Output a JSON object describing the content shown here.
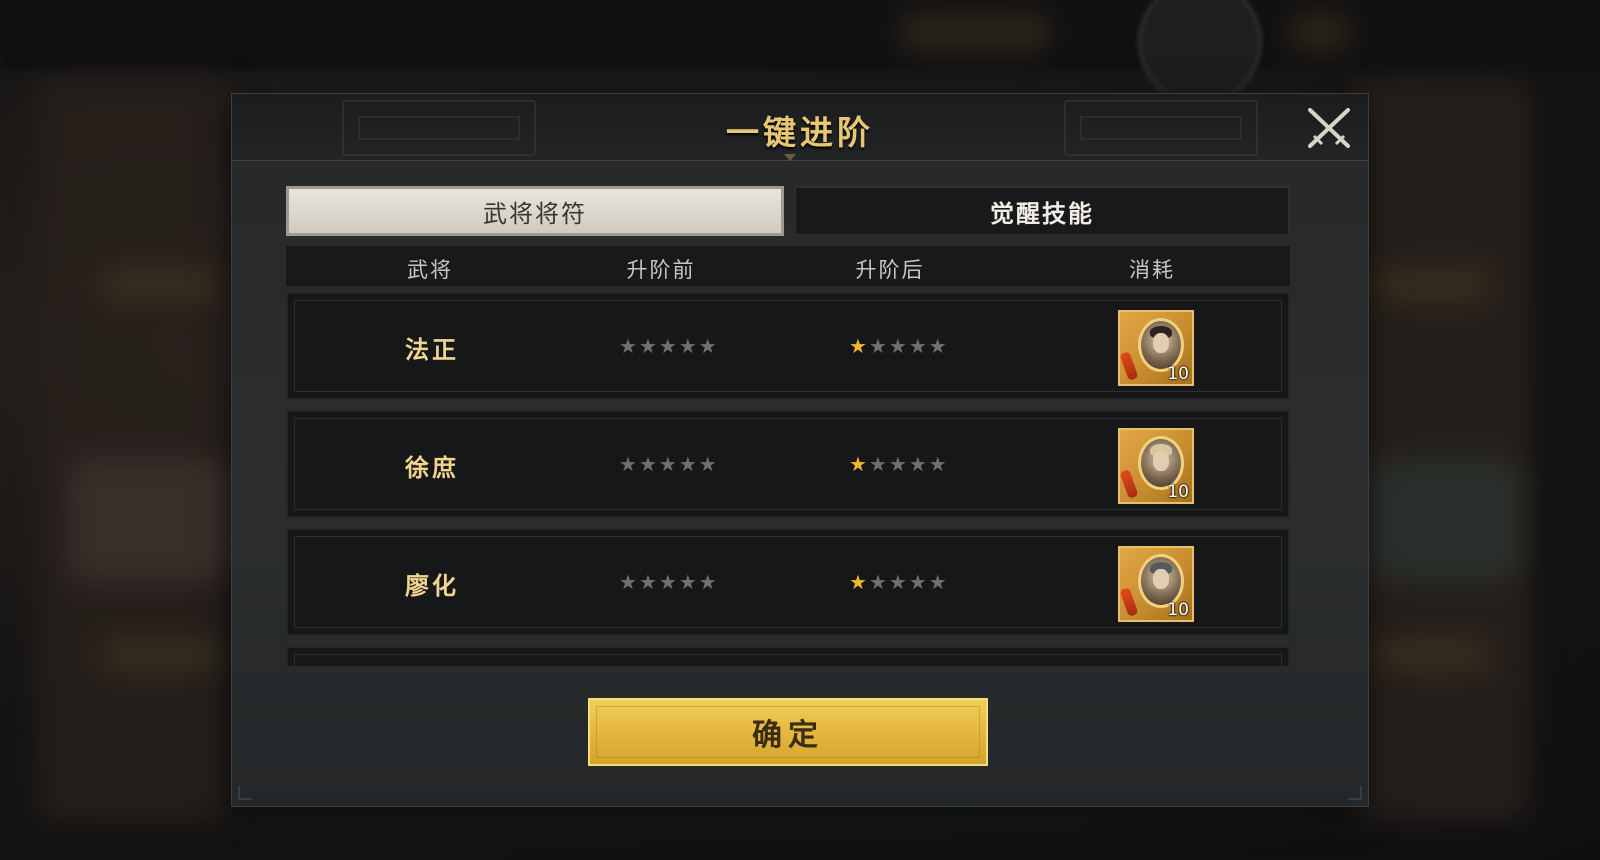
{
  "dialog": {
    "title": "一键进阶",
    "tabs": [
      {
        "label": "武将将符",
        "active": true
      },
      {
        "label": "觉醒技能",
        "active": false
      }
    ],
    "columns": [
      "武将",
      "升阶前",
      "升阶后",
      "消耗"
    ],
    "rows": [
      {
        "name": "法正",
        "stars_before": 0,
        "stars_after": 1,
        "stars_total": 5,
        "cost_count": "10",
        "cost_icon": "general-token-icon"
      },
      {
        "name": "徐庶",
        "stars_before": 0,
        "stars_after": 1,
        "stars_total": 5,
        "cost_count": "10",
        "cost_icon": "general-token-icon"
      },
      {
        "name": "廖化",
        "stars_before": 0,
        "stars_after": 1,
        "stars_total": 5,
        "cost_count": "10",
        "cost_icon": "general-token-icon"
      }
    ],
    "confirm_label": "确定",
    "close_icon": "crossed-swords-close-icon"
  },
  "colors": {
    "title_gold": "#e8c774",
    "name_gold": "#f1d58f",
    "star_on": "#f0b62c",
    "star_off": "#6f7072",
    "confirm_gold": "#e1b43b"
  }
}
